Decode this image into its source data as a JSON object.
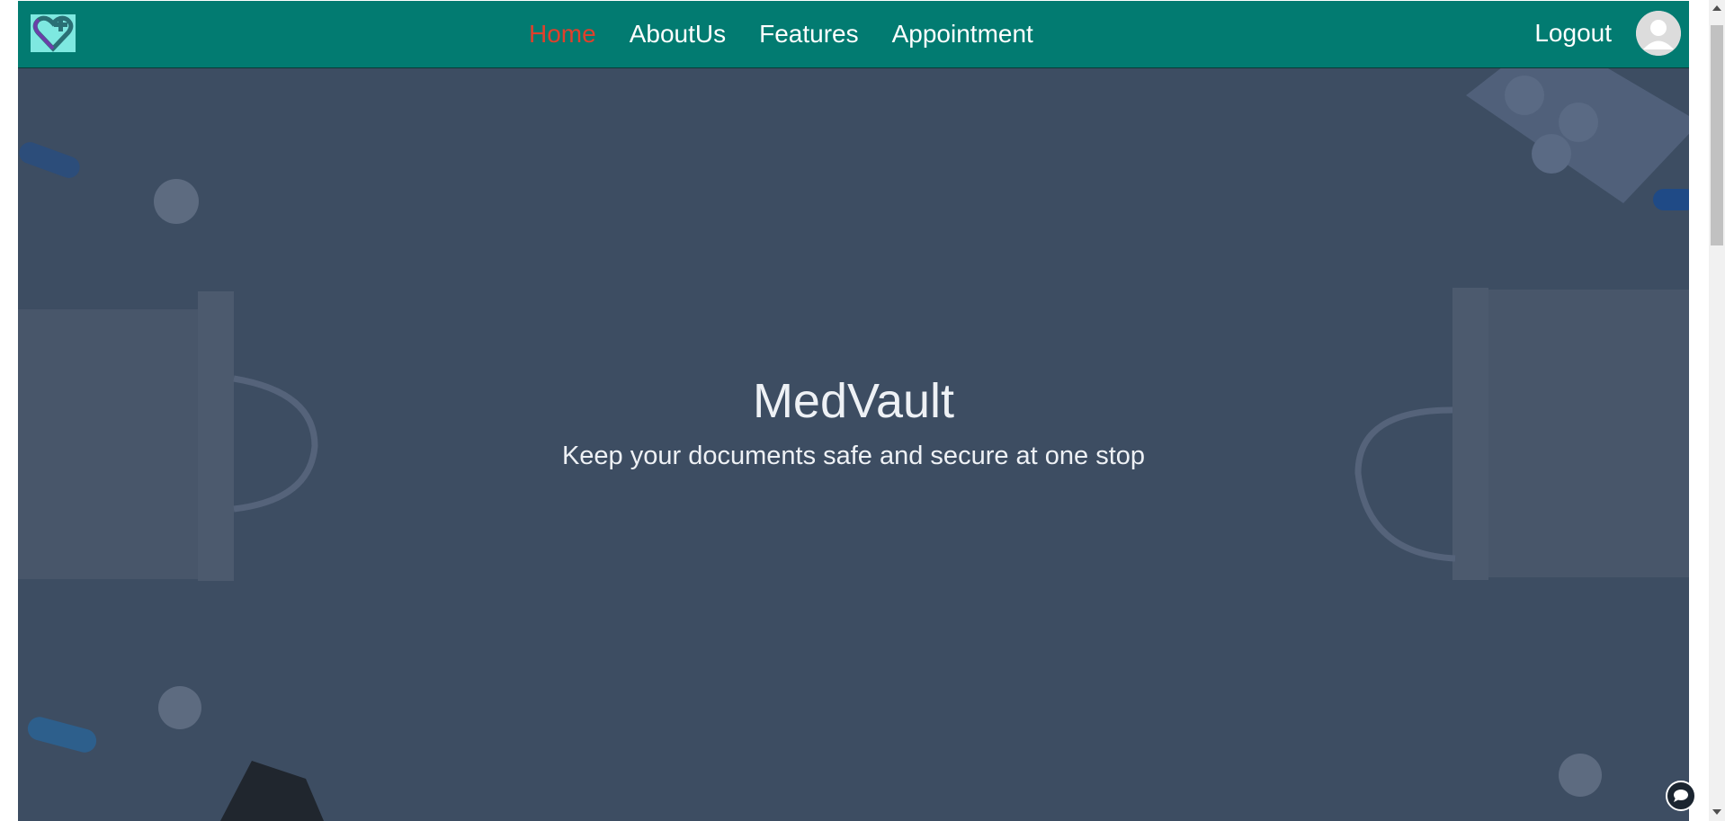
{
  "navbar": {
    "logo_icon": "heart-plus-icon",
    "links": [
      {
        "label": "Home",
        "active": true
      },
      {
        "label": "AboutUs",
        "active": false
      },
      {
        "label": "Features",
        "active": false
      },
      {
        "label": "Appointment",
        "active": false
      }
    ],
    "logout_label": "Logout",
    "avatar_icon": "user-avatar-icon",
    "colors": {
      "bar": "#027b71",
      "active_link": "#e0402c",
      "link": "#ffffff"
    }
  },
  "hero": {
    "title": "MedVault",
    "subtitle": "Keep your documents safe and secure at one stop",
    "overlay_color": "#3d4d62"
  },
  "widgets": {
    "chat_icon": "chat-bubble-icon"
  }
}
